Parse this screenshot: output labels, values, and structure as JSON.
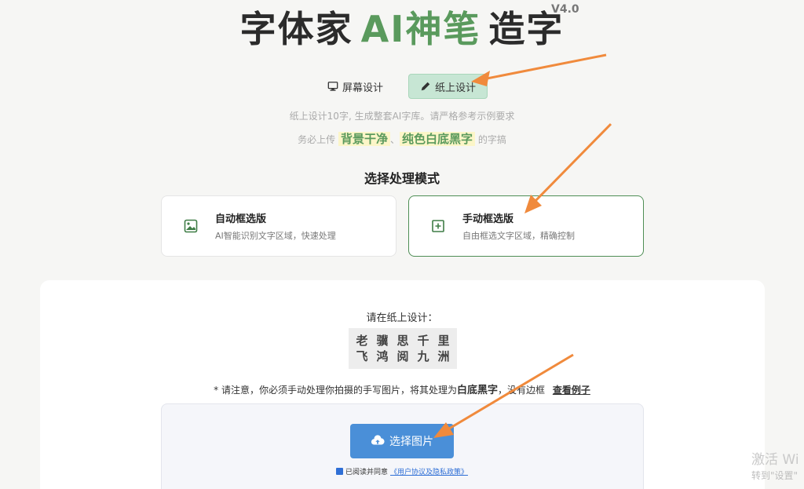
{
  "header": {
    "title_prefix": "字体家",
    "title_ai": "AI神笔",
    "title_suffix": "造字",
    "version": "V4.0"
  },
  "tabs": [
    {
      "label": "屏幕设计",
      "icon": "monitor-icon",
      "active": false
    },
    {
      "label": "纸上设计",
      "icon": "pencil-icon",
      "active": true
    }
  ],
  "intro": {
    "line1": "纸上设计10字, 生成整套AI字库。请严格参考示例要求",
    "line2_prefix": "务必上传",
    "highlight1": "背景干净",
    "separator": "、",
    "highlight2": "纯色白底黑字",
    "line2_suffix": "的字搞"
  },
  "mode_section": {
    "title": "选择处理模式",
    "modes": [
      {
        "name": "自动框选版",
        "desc": "AI智能识别文字区域，快速处理",
        "icon": "image-icon",
        "active": false
      },
      {
        "name": "手动框选版",
        "desc": "自由框选文字区域，精确控制",
        "icon": "plus-square-icon",
        "active": true
      }
    ]
  },
  "panel": {
    "prompt": "请在纸上设计：",
    "sample_row1": [
      "老",
      "骥",
      "思",
      "千",
      "里"
    ],
    "sample_row2": [
      "飞",
      "鸿",
      "阅",
      "九",
      "洲"
    ],
    "notice_prefix": "* 请注意，你必须手动处理你拍摄的手写图片，将其处理为",
    "notice_bold": "白底黑字",
    "notice_suffix": "，没有边框",
    "notice_link": "查看例子",
    "upload_label": "选择图片",
    "agree_text": "已阅读并同意",
    "agree_link": "《用户协议及隐私政策》"
  },
  "watermark": {
    "line1": "激活 Wi",
    "line2": "转到\"设置\""
  },
  "colors": {
    "accent_green": "#5a9a5d",
    "tab_active_bg": "#c7e6d4",
    "upload_blue": "#4a8fd8",
    "arrow_orange": "#f08a3c"
  }
}
